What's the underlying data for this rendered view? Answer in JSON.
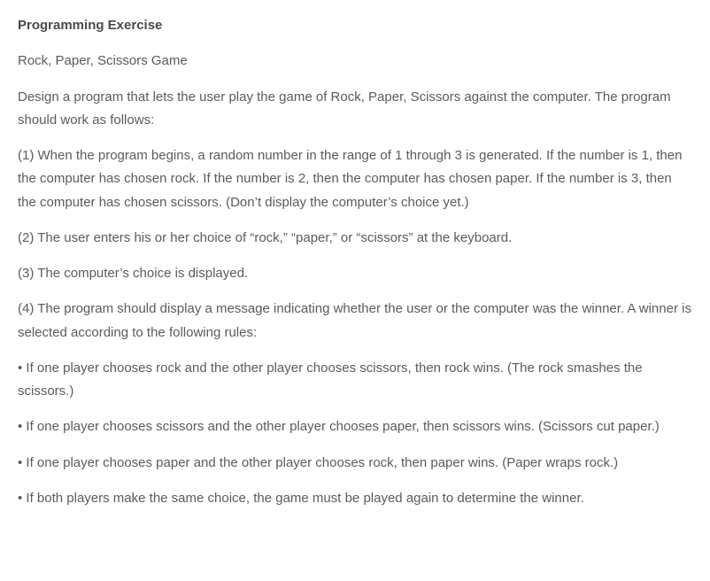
{
  "title": "Programming Exercise",
  "subtitle": "Rock, Paper, Scissors Game",
  "intro": "Design a program that lets the user play the game of Rock, Paper, Scissors against the computer. The program should work as follows:",
  "step1": "(1) When the program begins, a random number in the range of 1 through 3 is generated. If the number is 1, then the computer has chosen rock. If the number is 2, then the computer has chosen paper. If the number is 3, then the computer has chosen scissors. (Don’t display the computer’s choice yet.)",
  "step2": "(2) The user enters his or her choice of “rock,” “paper,” or “scissors” at the keyboard.",
  "step3": "(3) The computer’s choice is displayed.",
  "step4": "(4) The program should display a message indicating whether the user or the computer was the winner. A winner is selected according to the following rules:",
  "rule1": "• If one player chooses rock and the other player chooses scissors, then rock wins. (The rock smashes the scissors.)",
  "rule2": "• If one player chooses scissors and the other player chooses paper, then scissors wins. (Scissors cut paper.)",
  "rule3": "• If one player chooses paper and the other player chooses rock, then paper wins. (Paper wraps rock.)",
  "rule4": "• If both players make the same choice, the game must be played again to determine the winner."
}
